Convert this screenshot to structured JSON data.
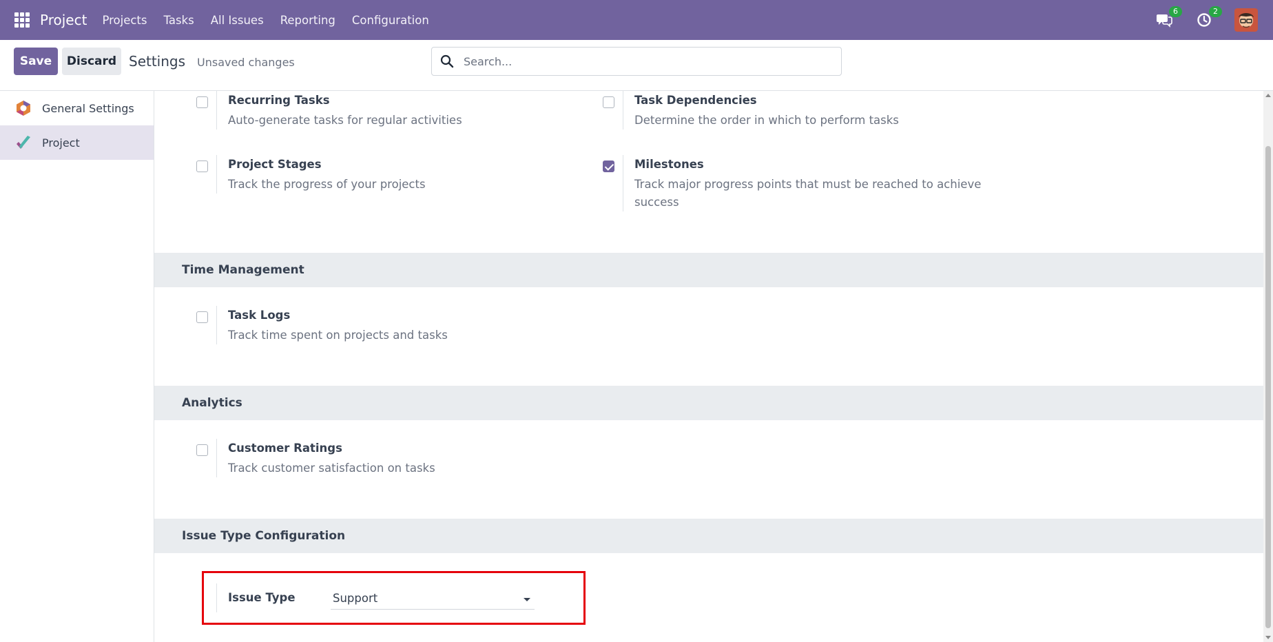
{
  "navbar": {
    "app_name": "Project",
    "menu": [
      "Projects",
      "Tasks",
      "All Issues",
      "Reporting",
      "Configuration"
    ],
    "messages_count": "6",
    "activities_count": "2",
    "color": "#71639e"
  },
  "control": {
    "save_label": "Save",
    "discard_label": "Discard",
    "breadcrumb": "Settings",
    "status": "Unsaved changes",
    "search_placeholder": "Search..."
  },
  "sidebar": {
    "items": [
      {
        "label": "General Settings",
        "icon": "odoo-hexagon-icon",
        "active": false
      },
      {
        "label": "Project",
        "icon": "project-checkmark-icon",
        "active": true
      }
    ]
  },
  "settings": {
    "recurring_tasks": {
      "title": "Recurring Tasks",
      "desc": "Auto-generate tasks for regular activities",
      "checked": false
    },
    "task_dependencies": {
      "title": "Task Dependencies",
      "desc": "Determine the order in which to perform tasks",
      "checked": false
    },
    "project_stages": {
      "title": "Project Stages",
      "desc": "Track the progress of your projects",
      "checked": false
    },
    "milestones": {
      "title": "Milestones",
      "desc": "Track major progress points that must be reached to achieve success",
      "checked": true
    },
    "time_management": {
      "heading": "Time Management",
      "task_logs": {
        "title": "Task Logs",
        "desc": "Track time spent on projects and tasks",
        "checked": false
      }
    },
    "analytics": {
      "heading": "Analytics",
      "customer_ratings": {
        "title": "Customer Ratings",
        "desc": "Track customer satisfaction on tasks",
        "checked": false
      }
    },
    "issue_type_config": {
      "heading": "Issue Type Configuration",
      "issue_type_label": "Issue Type",
      "issue_type_value": "Support"
    }
  }
}
